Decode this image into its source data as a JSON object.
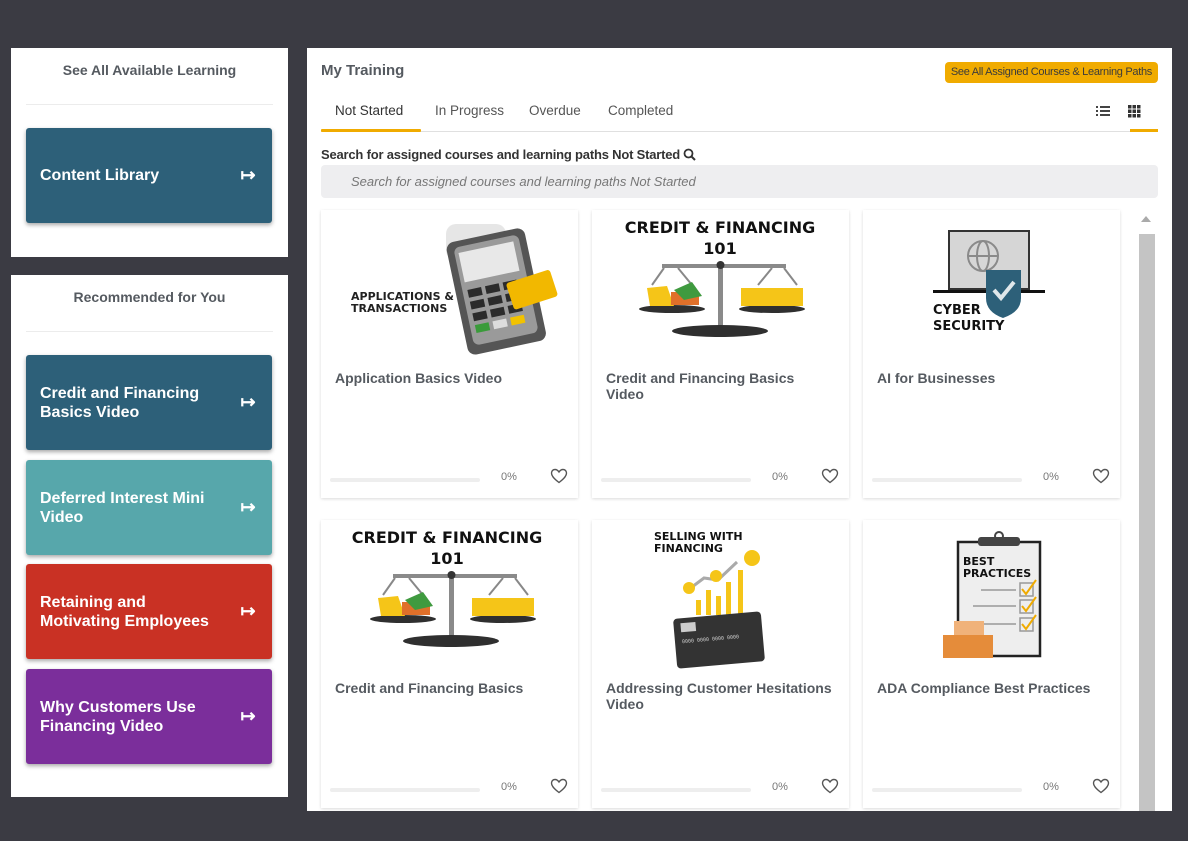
{
  "left_panels": {
    "available": {
      "title": "See All Available Learning",
      "tiles": [
        {
          "label": "Content Library",
          "color": "#2d6079",
          "icon": "arrow-right-bar-icon"
        }
      ]
    },
    "recommended": {
      "title": "Recommended for You",
      "tiles": [
        {
          "label": "Credit and Financing Basics Video",
          "color": "#2d6079",
          "icon": "arrow-right-bar-icon"
        },
        {
          "label": "Deferred Interest Mini Video",
          "color": "#57a7ab",
          "icon": "arrow-right-bar-icon"
        },
        {
          "label": "Retaining and Motivating Employees",
          "color": "#c93124",
          "icon": "arrow-right-bar-icon"
        },
        {
          "label": "Why Customers Use Financing Video",
          "color": "#7b2e9b",
          "icon": "arrow-right-bar-icon"
        }
      ]
    }
  },
  "main": {
    "title": "My Training",
    "see_all_button": "See All Assigned Courses & Learning Paths",
    "tabs": [
      {
        "label": "Not Started",
        "active": true
      },
      {
        "label": "In Progress",
        "active": false
      },
      {
        "label": "Overdue",
        "active": false
      },
      {
        "label": "Completed",
        "active": false
      }
    ],
    "view_modes": {
      "list": "list-view-icon",
      "grid": "grid-view-icon",
      "active": "grid"
    },
    "search": {
      "label": "Search for assigned courses and learning paths Not Started",
      "placeholder": "Search for assigned courses and learning paths Not Started"
    },
    "courses": [
      {
        "title": "Application Basics Video",
        "image_text": "APPLICATIONS & TRANSACTIONS",
        "image": "payment-terminal-illustration",
        "progress": 0,
        "progress_label": "0%"
      },
      {
        "title": "Credit and Financing Basics Video",
        "image_text": "CREDIT & FINANCING 101",
        "image": "balance-scale-illustration",
        "progress": 0,
        "progress_label": "0%"
      },
      {
        "title": "AI for Businesses",
        "image_text": "CYBER SECURITY",
        "image": "laptop-shield-illustration",
        "progress": 0,
        "progress_label": "0%"
      },
      {
        "title": "Credit and Financing Basics",
        "image_text": "CREDIT & FINANCING 101",
        "image": "balance-scale-illustration",
        "progress": 0,
        "progress_label": "0%"
      },
      {
        "title": "Addressing Customer Hesitations Video",
        "image_text": "SELLING WITH FINANCING",
        "image": "credit-card-growth-illustration",
        "progress": 0,
        "progress_label": "0%"
      },
      {
        "title": "ADA Compliance Best Practices",
        "image_text": "BEST PRACTICES",
        "image": "clipboard-checklist-illustration",
        "progress": 0,
        "progress_label": "0%"
      }
    ]
  },
  "colors": {
    "accent": "#f0ab00",
    "background": "#3b3b43"
  }
}
